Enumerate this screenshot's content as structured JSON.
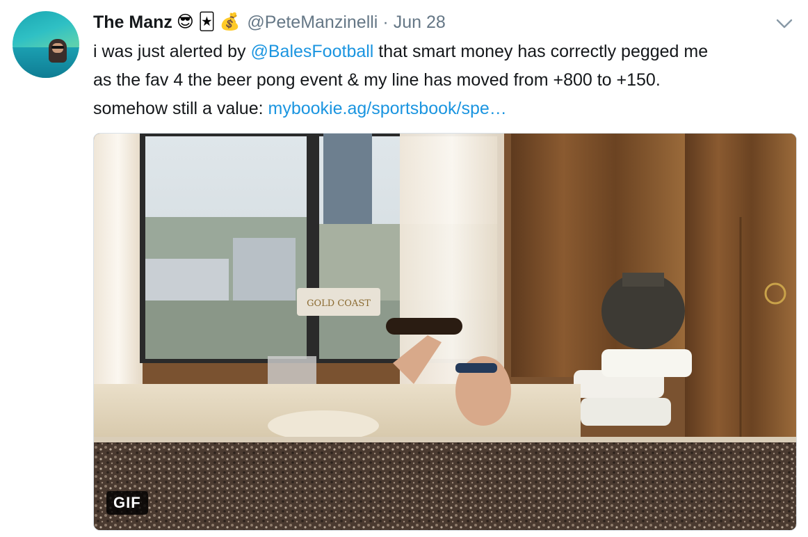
{
  "tweet": {
    "display_name": "The Manz",
    "name_emojis": [
      "😎",
      "🃏",
      "💰"
    ],
    "handle": "@PeteManzinelli",
    "separator": "·",
    "date": "Jun 28",
    "text": {
      "line1_pre": "i was just alerted by ",
      "mention": "@BalesFootball",
      "line1_post": " that smart money has correctly pegged me",
      "line2": "as the fav 4 the beer pong event & my line has moved from +800 to +150.",
      "line3_pre": "somehow still a value: ",
      "url": "mybookie.ag/sportsbook/spe…"
    },
    "media": {
      "badge": "GIF",
      "sign_text": "GOLD COAST"
    }
  },
  "icons": {
    "avatar": "avatar-photo",
    "more": "chevron-down-icon"
  },
  "colors": {
    "text": "#14171a",
    "secondary": "#657786",
    "link": "#1b95e0"
  }
}
